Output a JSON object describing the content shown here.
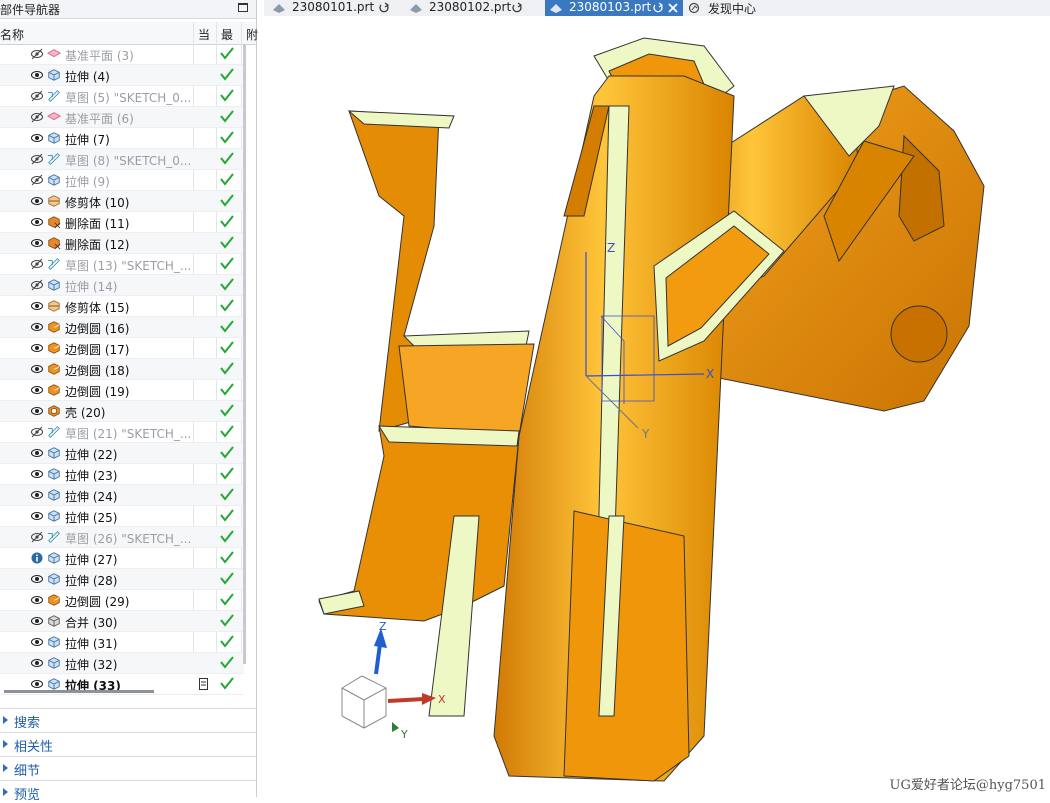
{
  "navigator": {
    "title": "部件导航器",
    "columns": {
      "name": "名称",
      "current": "当",
      "latest": "最",
      "attached": "附"
    },
    "rows": [
      {
        "label": "基准平面 (3)",
        "type": "datum",
        "suppressed": true
      },
      {
        "label": "拉伸 (4)",
        "type": "extrude"
      },
      {
        "label": "草图 (5) \"SKETCH_0...",
        "type": "sketch",
        "suppressed": true
      },
      {
        "label": "基准平面 (6)",
        "type": "datum",
        "suppressed": true
      },
      {
        "label": "拉伸 (7)",
        "type": "extrude"
      },
      {
        "label": "草图 (8) \"SKETCH_0...",
        "type": "sketch",
        "suppressed": true
      },
      {
        "label": "拉伸 (9)",
        "type": "extrude",
        "suppressed": true
      },
      {
        "label": "修剪体 (10)",
        "type": "trim"
      },
      {
        "label": "删除面 (11)",
        "type": "delete-face"
      },
      {
        "label": "删除面 (12)",
        "type": "delete-face"
      },
      {
        "label": "草图 (13) \"SKETCH_...",
        "type": "sketch",
        "suppressed": true
      },
      {
        "label": "拉伸 (14)",
        "type": "extrude",
        "suppressed": true
      },
      {
        "label": "修剪体 (15)",
        "type": "trim"
      },
      {
        "label": "边倒圆 (16)",
        "type": "blend"
      },
      {
        "label": "边倒圆 (17)",
        "type": "blend"
      },
      {
        "label": "边倒圆 (18)",
        "type": "blend"
      },
      {
        "label": "边倒圆 (19)",
        "type": "blend"
      },
      {
        "label": "壳 (20)",
        "type": "shell"
      },
      {
        "label": "草图 (21) \"SKETCH_...",
        "type": "sketch",
        "suppressed": true
      },
      {
        "label": "拉伸 (22)",
        "type": "extrude"
      },
      {
        "label": "拉伸 (23)",
        "type": "extrude"
      },
      {
        "label": "拉伸 (24)",
        "type": "extrude"
      },
      {
        "label": "拉伸 (25)",
        "type": "extrude"
      },
      {
        "label": "草图 (26) \"SKETCH_...",
        "type": "sketch",
        "suppressed": true
      },
      {
        "label": "拉伸 (27)",
        "type": "extrude",
        "info": true
      },
      {
        "label": "拉伸 (28)",
        "type": "extrude"
      },
      {
        "label": "边倒圆 (29)",
        "type": "blend"
      },
      {
        "label": "合并 (30)",
        "type": "unite"
      },
      {
        "label": "拉伸 (31)",
        "type": "extrude"
      },
      {
        "label": "拉伸 (32)",
        "type": "extrude"
      },
      {
        "label": "拉伸 (33)",
        "type": "extrude",
        "current": true
      }
    ],
    "sections": [
      "搜索",
      "相关性",
      "细节",
      "预览"
    ]
  },
  "tabs": [
    {
      "label": "23080101.prt"
    },
    {
      "label": "23080102.prt"
    },
    {
      "label": "23080103.prt",
      "active": true
    },
    {
      "label": "发现中心"
    }
  ],
  "viewport": {
    "axis_labels": {
      "x": "X",
      "y": "Y",
      "z": "Z"
    },
    "triad_labels": {
      "x": "X",
      "y": "Y",
      "z": "Z"
    }
  },
  "watermark": "UG爱好者论坛@hyg7501",
  "colors": {
    "part_orange": "#f0960a",
    "section_face": "#eef8c4",
    "check_green": "#22aa33",
    "tab_active": "#3a79c2",
    "link_blue": "#1f5fa8"
  }
}
